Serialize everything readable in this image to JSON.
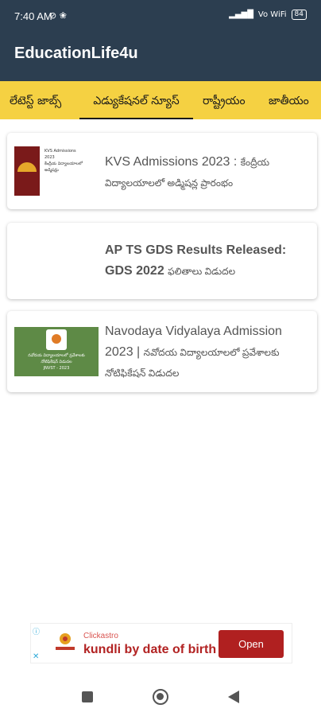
{
  "status": {
    "time": "7:40 AM",
    "left_icons": "⊘ ❀",
    "signal": "▂▄▆█",
    "network": "Vo WiFi",
    "battery": "84"
  },
  "app": {
    "title": "EducationLife4u"
  },
  "tabs": [
    {
      "label": "లేటెస్ట్ జాబ్స్",
      "active": false
    },
    {
      "label": "ఎడ్యుకేషనల్ న్యూస్",
      "active": true
    },
    {
      "label": "రాష్ట్రీయం",
      "active": false
    },
    {
      "label": "జాతీయం",
      "active": false
    }
  ],
  "articles": [
    {
      "title_en": "KVS Admissions 2023 :",
      "title_te": "కేంద్రీయ విద్యాలయాలలో అడ్మిషన్ల ప్రారంభం",
      "thumb_text": [
        "KVS Admissions",
        "2023",
        "కేంద్రీయ విద్యాలయాలలో",
        "అడ్మిషన్లు"
      ]
    },
    {
      "title_en": "AP TS GDS Results Released: GDS 2022",
      "title_te": "ఫలితాలు విడుదల"
    },
    {
      "title_en": "Navodaya Vidyalaya Admission 2023 |",
      "title_te": "నవోదయ విద్యాలయాలలో ప్రవేశాలకు నోటిఫికేషన్ విడుదల",
      "thumb_text": [
        "నవోదయ విద్యాలయాలలో ప్రవేశాలకు",
        "నోటిఫికేషన్ విడుదల",
        "JNVST - 2023"
      ]
    }
  ],
  "ad": {
    "source": "Clickastro",
    "headline": "kundli by date of birth",
    "button": "Open",
    "info_icon": "ⓘ",
    "close_icon": "✕",
    "brand_color": "#b02020"
  },
  "colors": {
    "app_bar": "#2c3e50",
    "tab_bar": "#f5d142"
  }
}
